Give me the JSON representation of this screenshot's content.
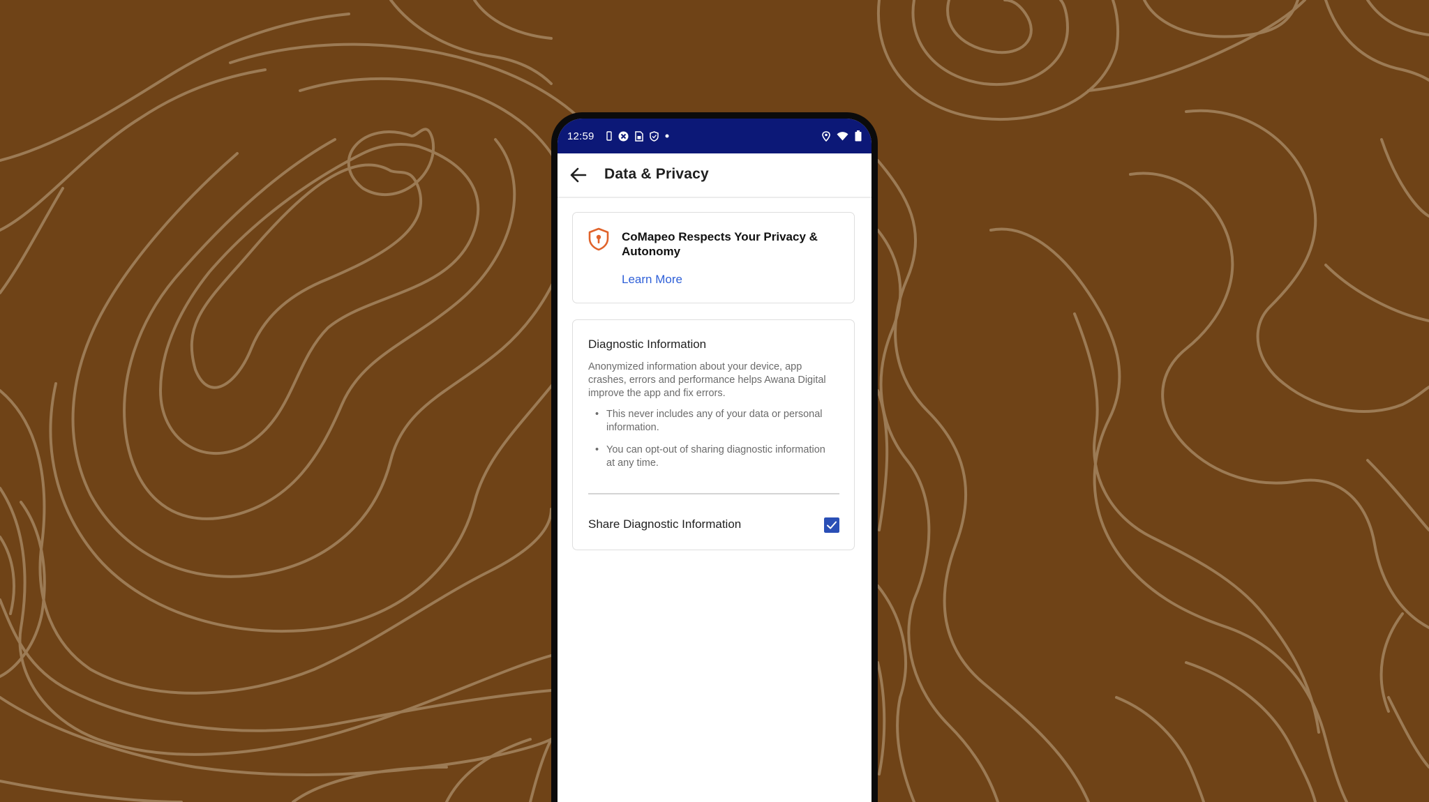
{
  "colors": {
    "background": "#6f4317",
    "contour_lines": "#a58560",
    "status_bar": "#0c1877",
    "accent_blue": "#2f60d8",
    "checkbox": "#2a4fb6",
    "shield_orange": "#e0632b"
  },
  "status_bar": {
    "time": "12:59",
    "left_icons": [
      "phone-outline-icon",
      "cross-circle-icon",
      "sim-doc-icon",
      "shield-outline-icon",
      "dot-icon"
    ],
    "right_icons": [
      "location-icon",
      "wifi-icon",
      "battery-icon"
    ]
  },
  "app_bar": {
    "back_icon": "arrow-left-icon",
    "title": "Data & Privacy"
  },
  "privacy_card": {
    "icon": "shield-alert-icon",
    "title": "CoMapeo Respects Your Privacy & Autonomy",
    "link": "Learn More"
  },
  "diagnostic_card": {
    "title": "Diagnostic Information",
    "description": "Anonymized information about your device, app crashes, errors and performance helps Awana Digital improve the app and fix errors.",
    "bullets": [
      "This never includes any of your data or personal information.",
      "You can opt-out of sharing diagnostic information at any time."
    ],
    "share_label": "Share Diagnostic Information",
    "share_checked": true
  }
}
